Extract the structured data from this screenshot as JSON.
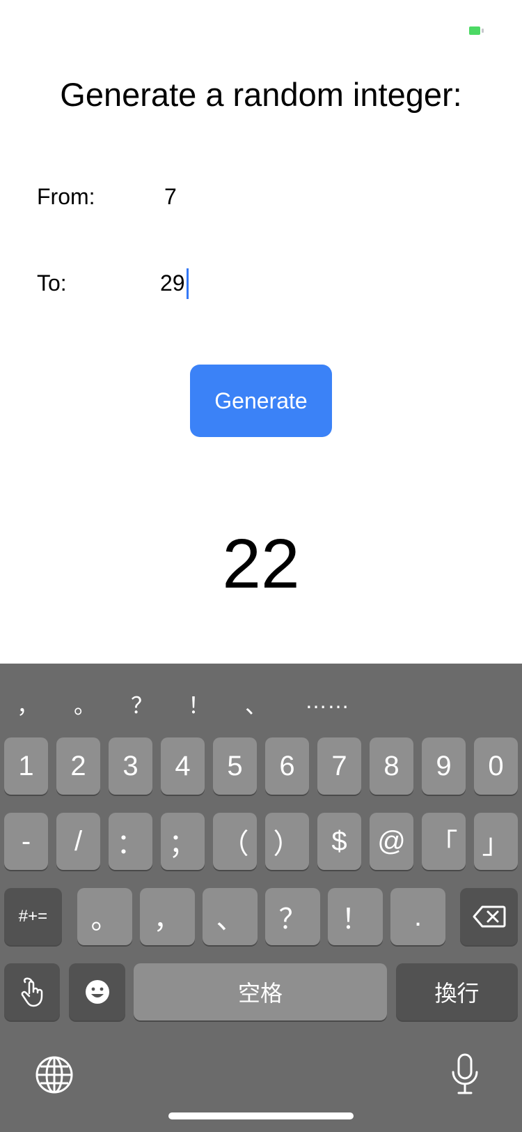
{
  "title": "Generate a random integer:",
  "from": {
    "label": "From:",
    "value": "7"
  },
  "to": {
    "label": "To:",
    "value": "29"
  },
  "generate_button": "Generate",
  "result": "22",
  "keyboard": {
    "candidates": [
      "，",
      "。",
      "？",
      "！",
      "、",
      "……"
    ],
    "row1": [
      "1",
      "2",
      "3",
      "4",
      "5",
      "6",
      "7",
      "8",
      "9",
      "0"
    ],
    "row2": [
      "-",
      "/",
      "：",
      "；",
      "（",
      "）",
      "$",
      "@",
      "「",
      "」"
    ],
    "row3": {
      "shift": "#+=",
      "keys": [
        "。",
        "，",
        "、",
        "？",
        "！",
        "."
      ]
    },
    "row4": {
      "space": "空格",
      "return": "換行"
    }
  },
  "icons": {
    "battery": "battery-icon",
    "delete": "delete-icon",
    "handwriting": "handwriting-icon",
    "emoji": "emoji-icon",
    "globe": "globe-icon",
    "mic": "microphone-icon"
  }
}
